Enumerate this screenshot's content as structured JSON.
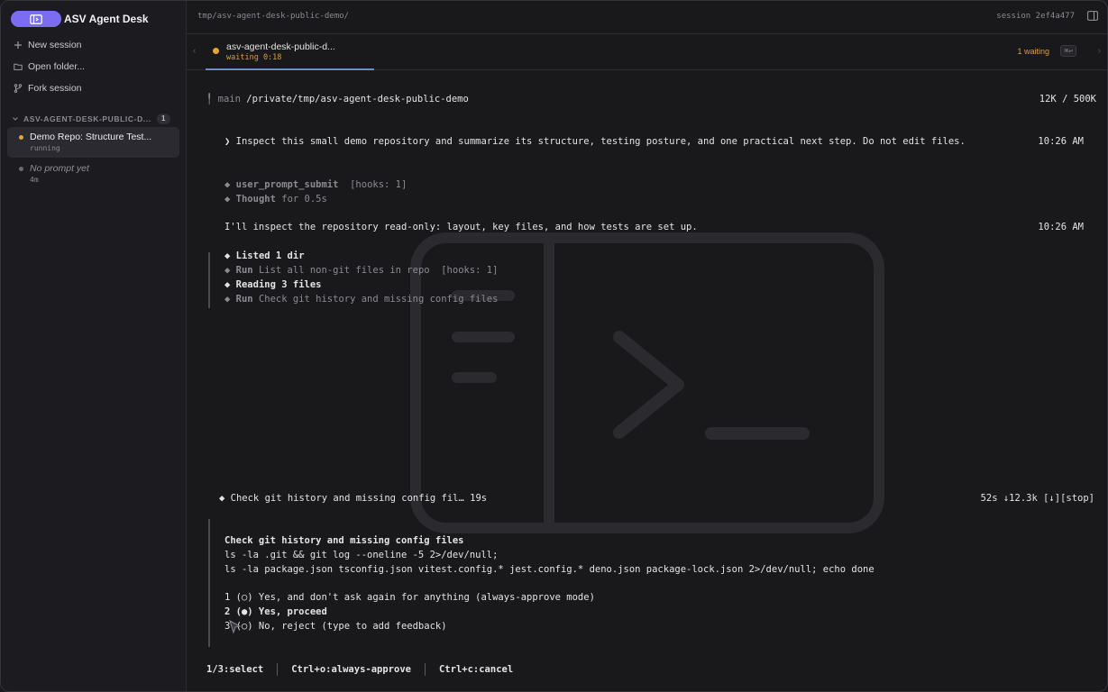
{
  "app": {
    "name": "ASV Agent Desk",
    "accent": "#7b6df2"
  },
  "sidebar": {
    "actions": [
      {
        "label": "New session",
        "icon": "plus-icon"
      },
      {
        "label": "Open folder...",
        "icon": "folder-icon"
      },
      {
        "label": "Fork session",
        "icon": "fork-icon"
      }
    ],
    "group": {
      "label": "ASV-AGENT-DESK-PUBLIC-D...",
      "count": "1"
    },
    "sessions": [
      {
        "title": "Demo Repo: Structure Test...",
        "status": "running",
        "dot_color": "#e0a63a"
      },
      {
        "title": "No prompt yet",
        "status": "4m",
        "dot_color": "#6a6a72"
      }
    ]
  },
  "topbar": {
    "path": "tmp/asv-agent-desk-public-demo/",
    "session": "session 2ef4a477"
  },
  "tabbar": {
    "tab": {
      "title": "asv-agent-desk-public-d...",
      "status": "waiting 0:18"
    },
    "waiting": "1 waiting",
    "shortcut": "⌘↩"
  },
  "terminal": {
    "branch_icon": "╿",
    "branch": "main",
    "cwd": "/private/tmp/asv-agent-desk-public-demo",
    "tokens": "12K / 500K",
    "prompt": "❯ Inspect this small demo repository and summarize its structure, testing posture, and one practical next step. Do not edit files.",
    "prompt_time": "10:26 AM",
    "hook": {
      "bullet": "◆",
      "name": "user_prompt_submit",
      "meta": " [hooks: 1]"
    },
    "thought": {
      "bullet": "◆",
      "name": "Thought",
      "meta": " for 0.5s"
    },
    "message": "I'll inspect the repository read-only: layout, key files, and how tests are set up.",
    "message_time": "10:26 AM",
    "steps": [
      {
        "bullet": "◆",
        "name": "Listed 1 dir",
        "rest": ""
      },
      {
        "bullet": "◆",
        "name": "Run",
        "rest": " List all non-git files in repo  [hooks: 1]"
      },
      {
        "bullet": "◆",
        "name": "Reading 3 files",
        "rest": ""
      },
      {
        "bullet": "◆",
        "name": "Run",
        "rest": " Check git history and missing config files"
      }
    ],
    "running": "◆ Check git history and missing config fil… 19s",
    "running_stats": "52s ↓12.3k [↓][stop]",
    "approval": {
      "title": "Check git history and missing config files",
      "cmd1": "ls -la .git && git log --oneline -5 2>/dev/null;",
      "cmd2": "ls -la package.json tsconfig.json vitest.config.* jest.config.* deno.json package-lock.json 2>/dev/null; echo done",
      "options": [
        "1 (○) Yes, and don't ask again for anything (always-approve mode)",
        "2 (●) Yes, proceed",
        "3 (○) No, reject (type to add feedback)"
      ]
    },
    "footer": [
      "1/3:select",
      "Ctrl+o:always-approve",
      "Ctrl+c:cancel"
    ]
  }
}
